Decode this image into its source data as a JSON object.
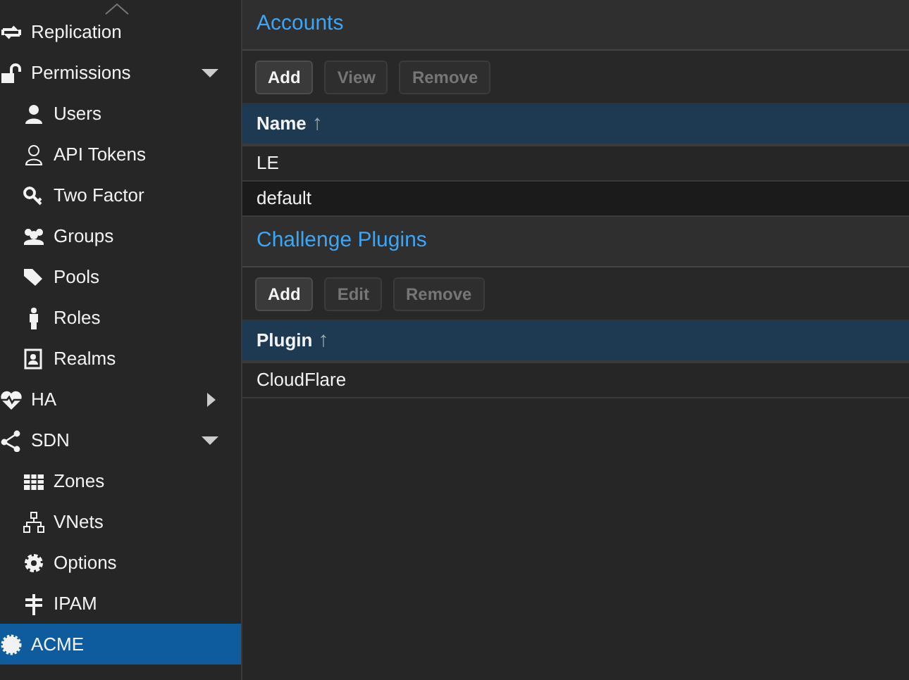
{
  "sidebar": {
    "items": [
      {
        "label": "Replication",
        "selected": false
      },
      {
        "label": "Permissions",
        "selected": false,
        "expanded": true,
        "children": [
          {
            "label": "Users",
            "selected": false
          },
          {
            "label": "API Tokens",
            "selected": false
          },
          {
            "label": "Two Factor",
            "selected": false
          },
          {
            "label": "Groups",
            "selected": false
          },
          {
            "label": "Pools",
            "selected": false
          },
          {
            "label": "Roles",
            "selected": false
          },
          {
            "label": "Realms",
            "selected": false
          }
        ]
      },
      {
        "label": "HA",
        "selected": false,
        "expanded": false
      },
      {
        "label": "SDN",
        "selected": false,
        "expanded": true,
        "children": [
          {
            "label": "Zones",
            "selected": false
          },
          {
            "label": "VNets",
            "selected": false
          },
          {
            "label": "Options",
            "selected": false
          },
          {
            "label": "IPAM",
            "selected": false
          }
        ]
      },
      {
        "label": "ACME",
        "selected": true
      }
    ]
  },
  "panels": [
    {
      "title": "Accounts",
      "buttons": [
        {
          "label": "Add",
          "disabled": false
        },
        {
          "label": "View",
          "disabled": true
        },
        {
          "label": "Remove",
          "disabled": true
        }
      ],
      "column": "Name",
      "sort_icon": "↑",
      "rows": [
        "LE",
        "default"
      ]
    },
    {
      "title": "Challenge Plugins",
      "buttons": [
        {
          "label": "Add",
          "disabled": false
        },
        {
          "label": "Edit",
          "disabled": true
        },
        {
          "label": "Remove",
          "disabled": true
        }
      ],
      "column": "Plugin",
      "sort_icon": "↑",
      "rows": [
        "CloudFlare"
      ]
    }
  ]
}
